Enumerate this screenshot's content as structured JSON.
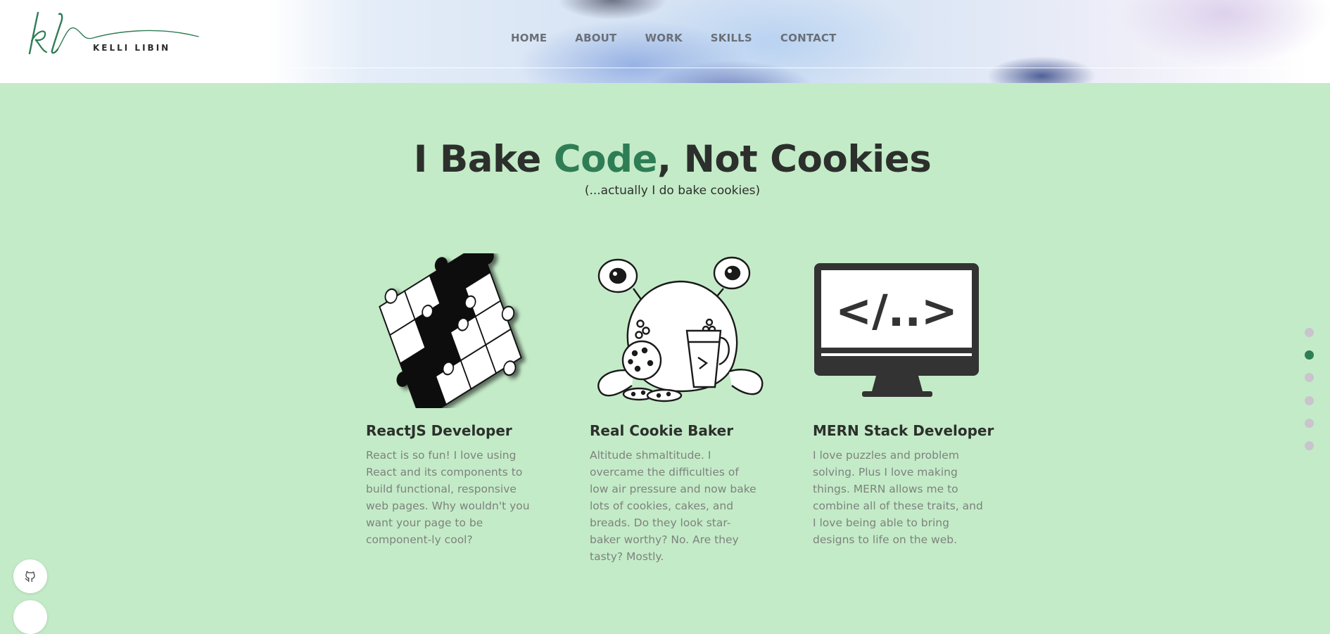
{
  "brand": {
    "monogram": "kl",
    "name": "KELLI LIBIN"
  },
  "nav": [
    {
      "label": "HOME"
    },
    {
      "label": "ABOUT"
    },
    {
      "label": "WORK"
    },
    {
      "label": "SKILLS"
    },
    {
      "label": "CONTACT"
    }
  ],
  "hero": {
    "title_part1": "I Bake ",
    "title_accent": "Code",
    "title_part2": ", Not Cookies",
    "subtitle": "(...actually I do bake cookies)"
  },
  "cards": [
    {
      "icon": "puzzle-icon",
      "title": "ReactJS Developer",
      "text": "React is so fun! I love using React and its components to build functional, responsive web pages. Why wouldn't you want your page to be component-ly cool?"
    },
    {
      "icon": "cookie-monster-icon",
      "title": "Real Cookie Baker",
      "text": "Altitude shmaltitude. I overcame the difficulties of low air pressure and now bake lots of cookies, cakes, and breads. Do they look star-baker worthy? No. Are they tasty? Mostly."
    },
    {
      "icon": "monitor-code-icon",
      "title": "MERN Stack Developer",
      "screen_text": "</..>",
      "text": "I love puzzles and problem solving. Plus I love making things. MERN allows me to combine all of these traits, and I love being able to bring designs to life on the web."
    }
  ],
  "section_dots": {
    "count": 6,
    "active_index": 1
  },
  "colors": {
    "accent": "#2f7d55",
    "background": "#c4ebc8",
    "heading": "#2c302c",
    "body_text": "#7d837d"
  },
  "social": [
    {
      "icon": "github-icon"
    }
  ]
}
